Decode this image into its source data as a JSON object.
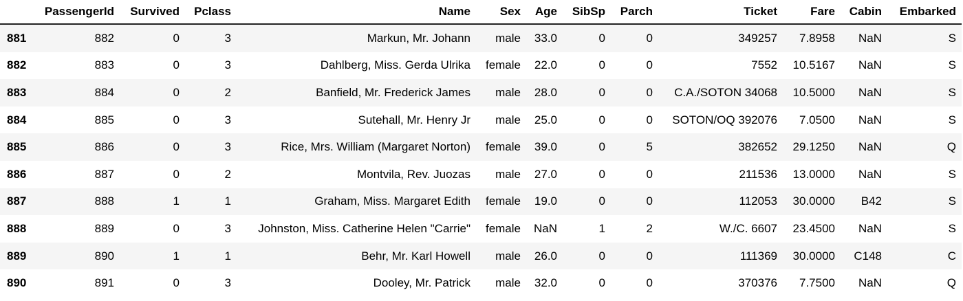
{
  "table": {
    "columns": [
      "",
      "PassengerId",
      "Survived",
      "Pclass",
      "Name",
      "Sex",
      "Age",
      "SibSp",
      "Parch",
      "Ticket",
      "Fare",
      "Cabin",
      "Embarked"
    ],
    "rows": [
      [
        "881",
        "882",
        "0",
        "3",
        "Markun, Mr. Johann",
        "male",
        "33.0",
        "0",
        "0",
        "349257",
        "7.8958",
        "NaN",
        "S"
      ],
      [
        "882",
        "883",
        "0",
        "3",
        "Dahlberg, Miss. Gerda Ulrika",
        "female",
        "22.0",
        "0",
        "0",
        "7552",
        "10.5167",
        "NaN",
        "S"
      ],
      [
        "883",
        "884",
        "0",
        "2",
        "Banfield, Mr. Frederick James",
        "male",
        "28.0",
        "0",
        "0",
        "C.A./SOTON 34068",
        "10.5000",
        "NaN",
        "S"
      ],
      [
        "884",
        "885",
        "0",
        "3",
        "Sutehall, Mr. Henry Jr",
        "male",
        "25.0",
        "0",
        "0",
        "SOTON/OQ 392076",
        "7.0500",
        "NaN",
        "S"
      ],
      [
        "885",
        "886",
        "0",
        "3",
        "Rice, Mrs. William (Margaret Norton)",
        "female",
        "39.0",
        "0",
        "5",
        "382652",
        "29.1250",
        "NaN",
        "Q"
      ],
      [
        "886",
        "887",
        "0",
        "2",
        "Montvila, Rev. Juozas",
        "male",
        "27.0",
        "0",
        "0",
        "211536",
        "13.0000",
        "NaN",
        "S"
      ],
      [
        "887",
        "888",
        "1",
        "1",
        "Graham, Miss. Margaret Edith",
        "female",
        "19.0",
        "0",
        "0",
        "112053",
        "30.0000",
        "B42",
        "S"
      ],
      [
        "888",
        "889",
        "0",
        "3",
        "Johnston, Miss. Catherine Helen \"Carrie\"",
        "female",
        "NaN",
        "1",
        "2",
        "W./C. 6607",
        "23.4500",
        "NaN",
        "S"
      ],
      [
        "889",
        "890",
        "1",
        "1",
        "Behr, Mr. Karl Howell",
        "male",
        "26.0",
        "0",
        "0",
        "111369",
        "30.0000",
        "C148",
        "C"
      ],
      [
        "890",
        "891",
        "0",
        "3",
        "Dooley, Mr. Patrick",
        "male",
        "32.0",
        "0",
        "0",
        "370376",
        "7.7500",
        "NaN",
        "Q"
      ]
    ]
  }
}
